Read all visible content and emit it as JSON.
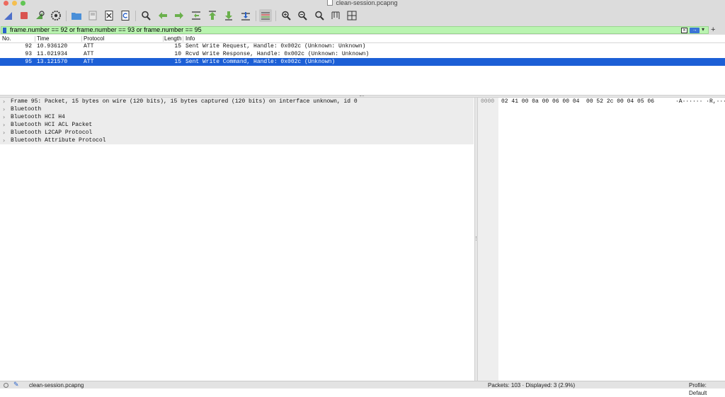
{
  "window": {
    "title": "clean-session.pcapng"
  },
  "toolbar": {
    "buttons": [
      "shark-fin-icon",
      "stop-icon",
      "restart-icon",
      "options-gear-icon",
      "open-folder-icon",
      "save-icon",
      "close-file-icon",
      "reload-icon",
      "find-packet-icon",
      "go-back-icon",
      "go-forward-icon",
      "go-to-packet-icon",
      "first-packet-icon",
      "last-packet-icon",
      "autoscroll-icon",
      "colorize-icon",
      "zoom-in-icon",
      "zoom-out-icon",
      "normal-size-icon",
      "resize-columns-icon",
      "layout-icon"
    ]
  },
  "filter": {
    "value": "frame.number == 92 or frame.number == 93 or frame.number == 95",
    "clear_glyph": "×",
    "apply_glyph": "→",
    "dropdown_glyph": "▾",
    "add_glyph": "+"
  },
  "packet_list": {
    "columns": {
      "no": "No.",
      "time": "Time",
      "protocol": "Protocol",
      "length": "Length",
      "info": "Info"
    },
    "rows": [
      {
        "no": "92",
        "time": "10.936120",
        "protocol": "ATT",
        "length": "15",
        "info": "Sent Write Request, Handle: 0x002c (Unknown: Unknown)",
        "selected": false
      },
      {
        "no": "93",
        "time": "11.021934",
        "protocol": "ATT",
        "length": "10",
        "info": "Rcvd Write Response, Handle: 0x002c (Unknown: Unknown)",
        "selected": false
      },
      {
        "no": "95",
        "time": "13.121570",
        "protocol": "ATT",
        "length": "15",
        "info": "Sent Write Command, Handle: 0x002c (Unknown)",
        "selected": true
      }
    ]
  },
  "details": {
    "arrow": "›",
    "items": [
      "Frame 95: Packet, 15 bytes on wire (120 bits), 15 bytes captured (120 bits) on interface unknown, id 0",
      "Bluetooth",
      "Bluetooth HCI H4",
      "Bluetooth HCI ACL Packet",
      "Bluetooth L2CAP Protocol",
      "Bluetooth Attribute Protocol"
    ]
  },
  "bytes": {
    "offset": "0000",
    "hex": "02 41 00 0a 00 06 00 04  00 52 2c 00 04 05 06",
    "ascii": "·A······ ·R,····"
  },
  "status": {
    "file": "clean-session.pcapng",
    "counts": "Packets: 103 · Displayed: 3 (2.9%)",
    "profile": "Profile: Default"
  },
  "colors": {
    "filter_valid": "#b9f4b0",
    "selection": "#1c5fd6",
    "toolbar_bg": "#dcdcdc"
  }
}
